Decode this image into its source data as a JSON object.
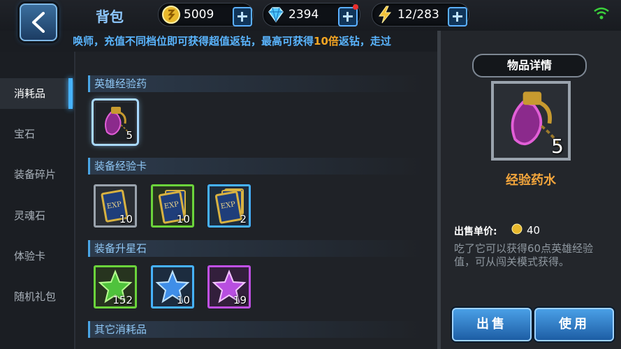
{
  "header": {
    "title": "背包"
  },
  "resources": {
    "gold": {
      "value": "5009",
      "icon": "gold-coin-icon"
    },
    "diamond": {
      "value": "2394",
      "icon": "diamond-icon"
    },
    "stamina": {
      "value": "12/283",
      "icon": "lightning-icon"
    }
  },
  "marquee": {
    "text_before": "召唤师，充值不同档位即可获得超值返钻，最高可获得",
    "highlight": "10倍",
    "text_after": "返钻，走过"
  },
  "sidebar": {
    "items": [
      {
        "label": "消耗品"
      },
      {
        "label": "宝石"
      },
      {
        "label": "装备碎片"
      },
      {
        "label": "灵魂石"
      },
      {
        "label": "体验卡"
      },
      {
        "label": "随机礼包"
      }
    ]
  },
  "inventory": {
    "sections": [
      {
        "label": "英雄经验药"
      },
      {
        "label": "装备经验卡"
      },
      {
        "label": "装备升星石"
      },
      {
        "label": "其它消耗品"
      }
    ],
    "hero_exp": [
      {
        "count": "5"
      }
    ],
    "equip_exp": [
      {
        "count": "10"
      },
      {
        "count": "10"
      },
      {
        "count": "2"
      }
    ],
    "star_stones": [
      {
        "count": "152"
      },
      {
        "count": "10"
      },
      {
        "count": "19"
      }
    ]
  },
  "detail": {
    "title": "物品详情",
    "count": "5",
    "name": "经验药水",
    "price_label": "出售单价:",
    "price": "40",
    "description": "吃了它可以获得60点英雄经验值，可从闯关模式获得。",
    "sell_label": "出售",
    "use_label": "使用"
  },
  "colors": {
    "accent": "#47b3ff",
    "item_name": "#f2a53c",
    "highlight": "#f6a623"
  }
}
